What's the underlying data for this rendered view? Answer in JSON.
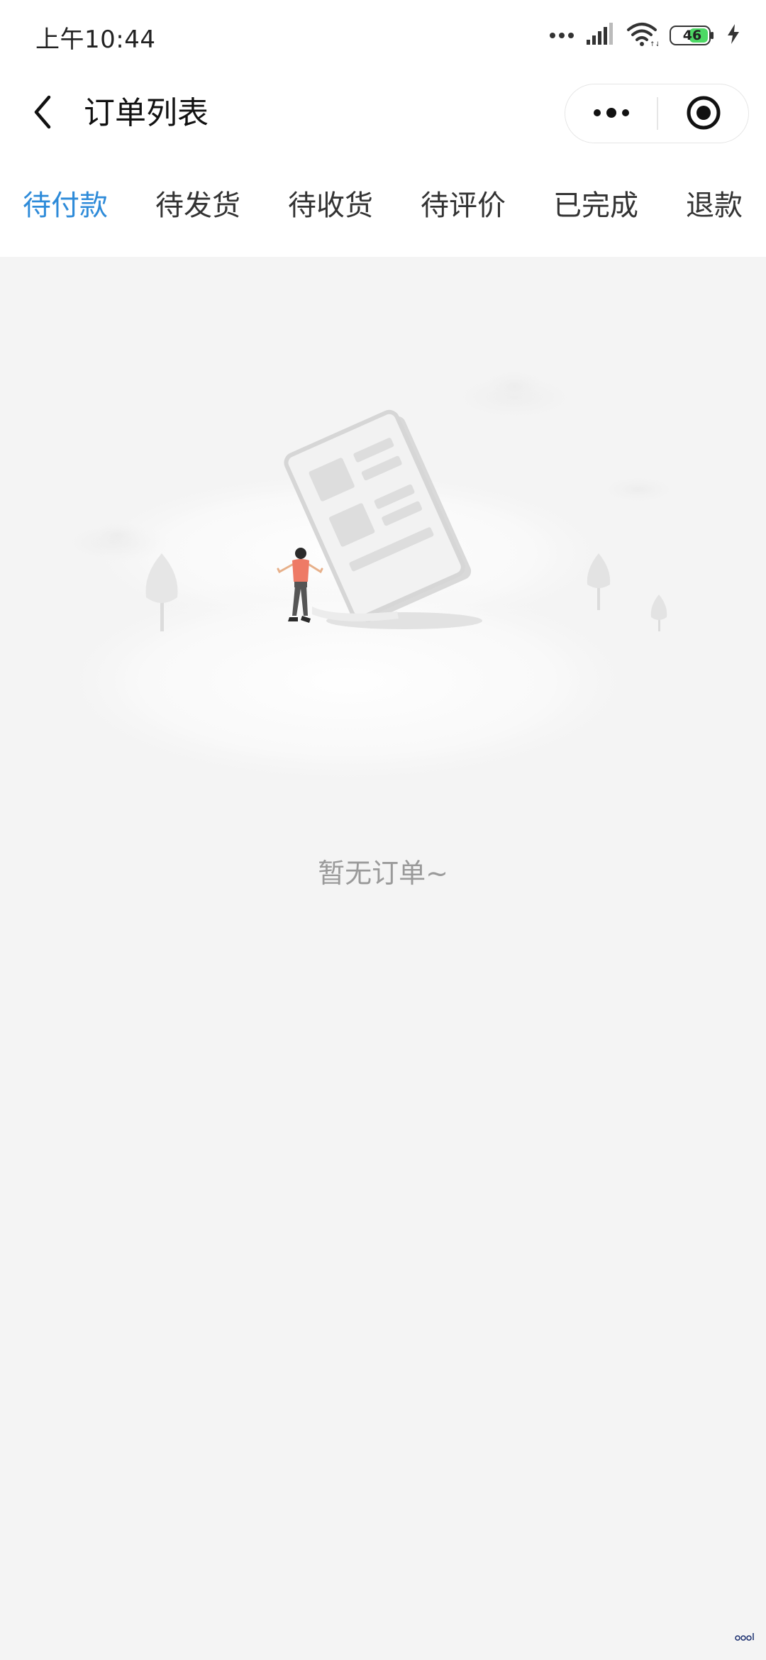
{
  "status_bar": {
    "time": "上午10:44",
    "battery_level": "46"
  },
  "nav": {
    "title": "订单列表"
  },
  "tabs": [
    {
      "label": "待付款",
      "active": true
    },
    {
      "label": "待发货",
      "active": false
    },
    {
      "label": "待收货",
      "active": false
    },
    {
      "label": "待评价",
      "active": false
    },
    {
      "label": "已完成",
      "active": false
    },
    {
      "label": "退款",
      "active": false
    }
  ],
  "empty_state": {
    "message": "暂无订单~"
  },
  "colors": {
    "accent": "#2e8bd9",
    "background": "#f4f4f4"
  }
}
